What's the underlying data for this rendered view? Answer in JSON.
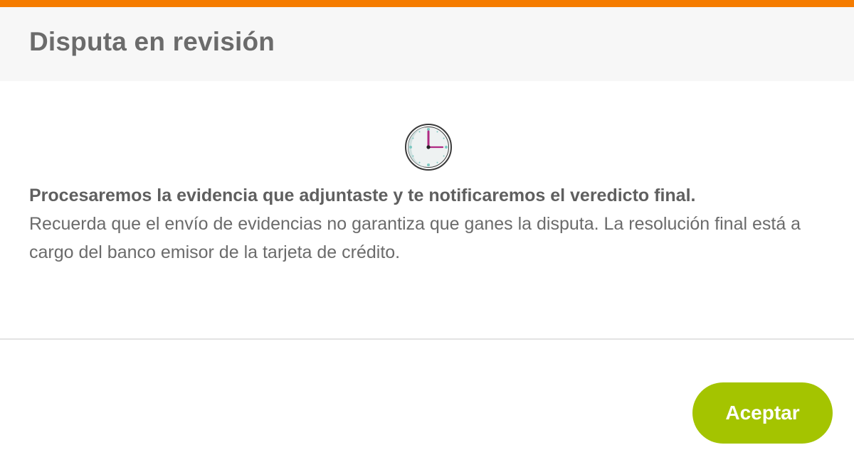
{
  "dialog": {
    "title": "Disputa en revisión",
    "message_bold": "Procesaremos la evidencia que adjuntaste y te notificaremos el veredicto final.",
    "message_body": "Recuerda que el envío de evidencias no garantiza que ganes la disputa. La resolución final está a cargo del banco emisor de la tarjeta de crédito.",
    "icon": "clock-icon",
    "accept_label": "Aceptar"
  },
  "colors": {
    "accent": "#f57c00",
    "button": "#a4c400",
    "clock_hand": "#b02a83",
    "clock_face": "#eef2f2",
    "clock_dots": "#7ec9c2"
  }
}
